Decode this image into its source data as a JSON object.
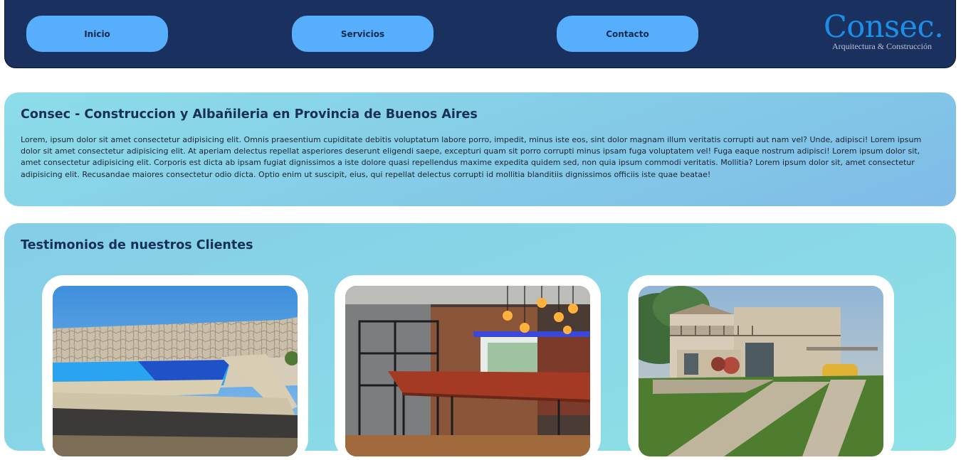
{
  "nav": {
    "items": [
      {
        "label": "Inicio"
      },
      {
        "label": "Servicios"
      },
      {
        "label": "Contacto"
      }
    ],
    "logo": {
      "wordmark": "Consec.",
      "tagline": "Arquitectura & Construcción"
    }
  },
  "intro": {
    "title": "Consec - Construccion y Albañileria en Provincia de Buenos Aires",
    "body": "Lorem, ipsum dolor sit amet consectetur adipisicing elit. Omnis praesentium cupiditate debitis voluptatum labore porro, impedit, minus iste eos, sint dolor magnam illum veritatis corrupti aut nam vel? Unde, adipisci! Lorem ipsum dolor sit amet consectetur adipisicing elit. At aperiam delectus repellat asperiores deserunt eligendi saepe, excepturi quam sit porro corrupti minus ipsam fuga voluptatem vel! Fuga eaque nostrum adipisci! Lorem ipsum dolor sit, amet consectetur adipisicing elit. Corporis est dicta ab ipsam fugiat dignissimos a iste dolore quasi repellendus maxime expedita quidem sed, non quia ipsum commodi veritatis. Mollitia? Lorem ipsum dolor sit, amet consectetur adipisicing elit. Recusandae maiores consectetur odio dicta. Optio enim ut suscipit, eius, qui repellat delectus corrupti id mollitia blanditiis dignissimos officiis iste quae beatae!"
  },
  "testimonials": {
    "title": "Testimonios de nuestros Clientes",
    "cards": [
      {
        "image": "pool-photo"
      },
      {
        "image": "interior-photo"
      },
      {
        "image": "house-photo"
      }
    ]
  },
  "colors": {
    "navbar": "#1a3160",
    "nav_button": "#56aefc",
    "logo": "#1d8ee6",
    "panel": "#88d3e8",
    "heading": "#173057"
  }
}
